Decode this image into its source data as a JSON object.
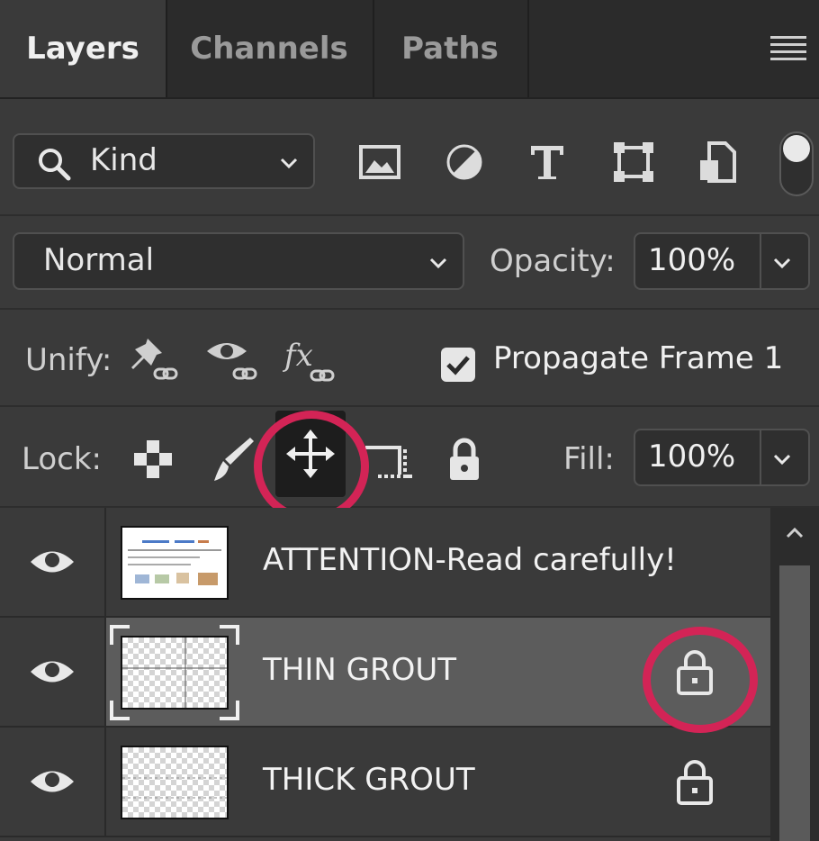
{
  "tabs": [
    {
      "label": "Layers",
      "active": true
    },
    {
      "label": "Channels",
      "active": false
    },
    {
      "label": "Paths",
      "active": false
    }
  ],
  "filter": {
    "kind_label": "Kind",
    "icons": [
      "image-filter-icon",
      "adjustment-filter-icon",
      "type-filter-icon",
      "shape-filter-icon",
      "smart-object-filter-icon"
    ]
  },
  "blend": {
    "mode": "Normal",
    "opacity_label": "Opacity:",
    "opacity_value": "100%"
  },
  "unify": {
    "label": "Unify:",
    "propagate_label": "Propagate Frame 1",
    "propagate_checked": true
  },
  "lock": {
    "label": "Lock:",
    "fill_label": "Fill:",
    "fill_value": "100%"
  },
  "layers": [
    {
      "name": "ATTENTION-Read carefully!",
      "visible": true,
      "locked": false,
      "selected": false
    },
    {
      "name": "THIN GROUT",
      "visible": true,
      "locked": true,
      "selected": true
    },
    {
      "name": "THICK GROUT",
      "visible": true,
      "locked": true,
      "selected": false
    }
  ],
  "colors": {
    "highlight_ring": "#d32456",
    "panel_bg": "#3a3a3a",
    "selected_row": "#5c5c5c"
  }
}
